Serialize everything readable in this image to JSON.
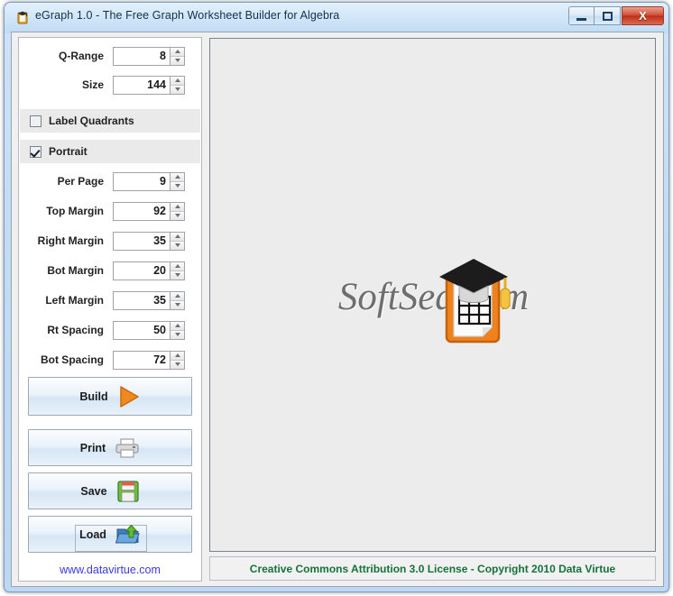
{
  "window": {
    "title": "eGraph 1.0 - The Free Graph Worksheet Builder for Algebra",
    "icon": "app-clipboard-cap-icon",
    "buttons": {
      "minimize": "minimize",
      "maximize": "maximize",
      "close": "X"
    }
  },
  "sidebar": {
    "fields": [
      {
        "label": "Q-Range",
        "value": "8",
        "name": "q-range"
      },
      {
        "label": "Size",
        "value": "144",
        "name": "size"
      },
      {
        "label": "Per Page",
        "value": "9",
        "name": "per-page"
      },
      {
        "label": "Top Margin",
        "value": "92",
        "name": "top-margin"
      },
      {
        "label": "Right Margin",
        "value": "35",
        "name": "right-margin"
      },
      {
        "label": "Bot Margin",
        "value": "20",
        "name": "bot-margin"
      },
      {
        "label": "Left Margin",
        "value": "35",
        "name": "left-margin"
      },
      {
        "label": "Rt Spacing",
        "value": "50",
        "name": "rt-spacing"
      },
      {
        "label": "Bot Spacing",
        "value": "72",
        "name": "bot-spacing"
      }
    ],
    "checkboxes": [
      {
        "label": "Label Quadrants",
        "checked": false
      },
      {
        "label": "Portrait",
        "checked": true
      }
    ],
    "buttons": [
      {
        "label": "Build",
        "icon": "play-triangle-icon"
      },
      {
        "label": "Print",
        "icon": "printer-icon"
      },
      {
        "label": "Save",
        "icon": "floppy-disk-icon"
      },
      {
        "label": "Load",
        "icon": "open-folder-up-arrow-icon"
      }
    ],
    "link": "www.datavirtue.com"
  },
  "preview": {
    "watermark": "SoftSea.com",
    "logo": "graduation-cap-clipboard-logo"
  },
  "statusbar": {
    "text": "Creative Commons Attribution 3.0 License - Copyright 2010 Data Virtue"
  },
  "colors": {
    "accent_orange": "#f08a1e",
    "status_green": "#17713b",
    "link_blue": "#3b3bdb",
    "title_text": "#12304d"
  }
}
